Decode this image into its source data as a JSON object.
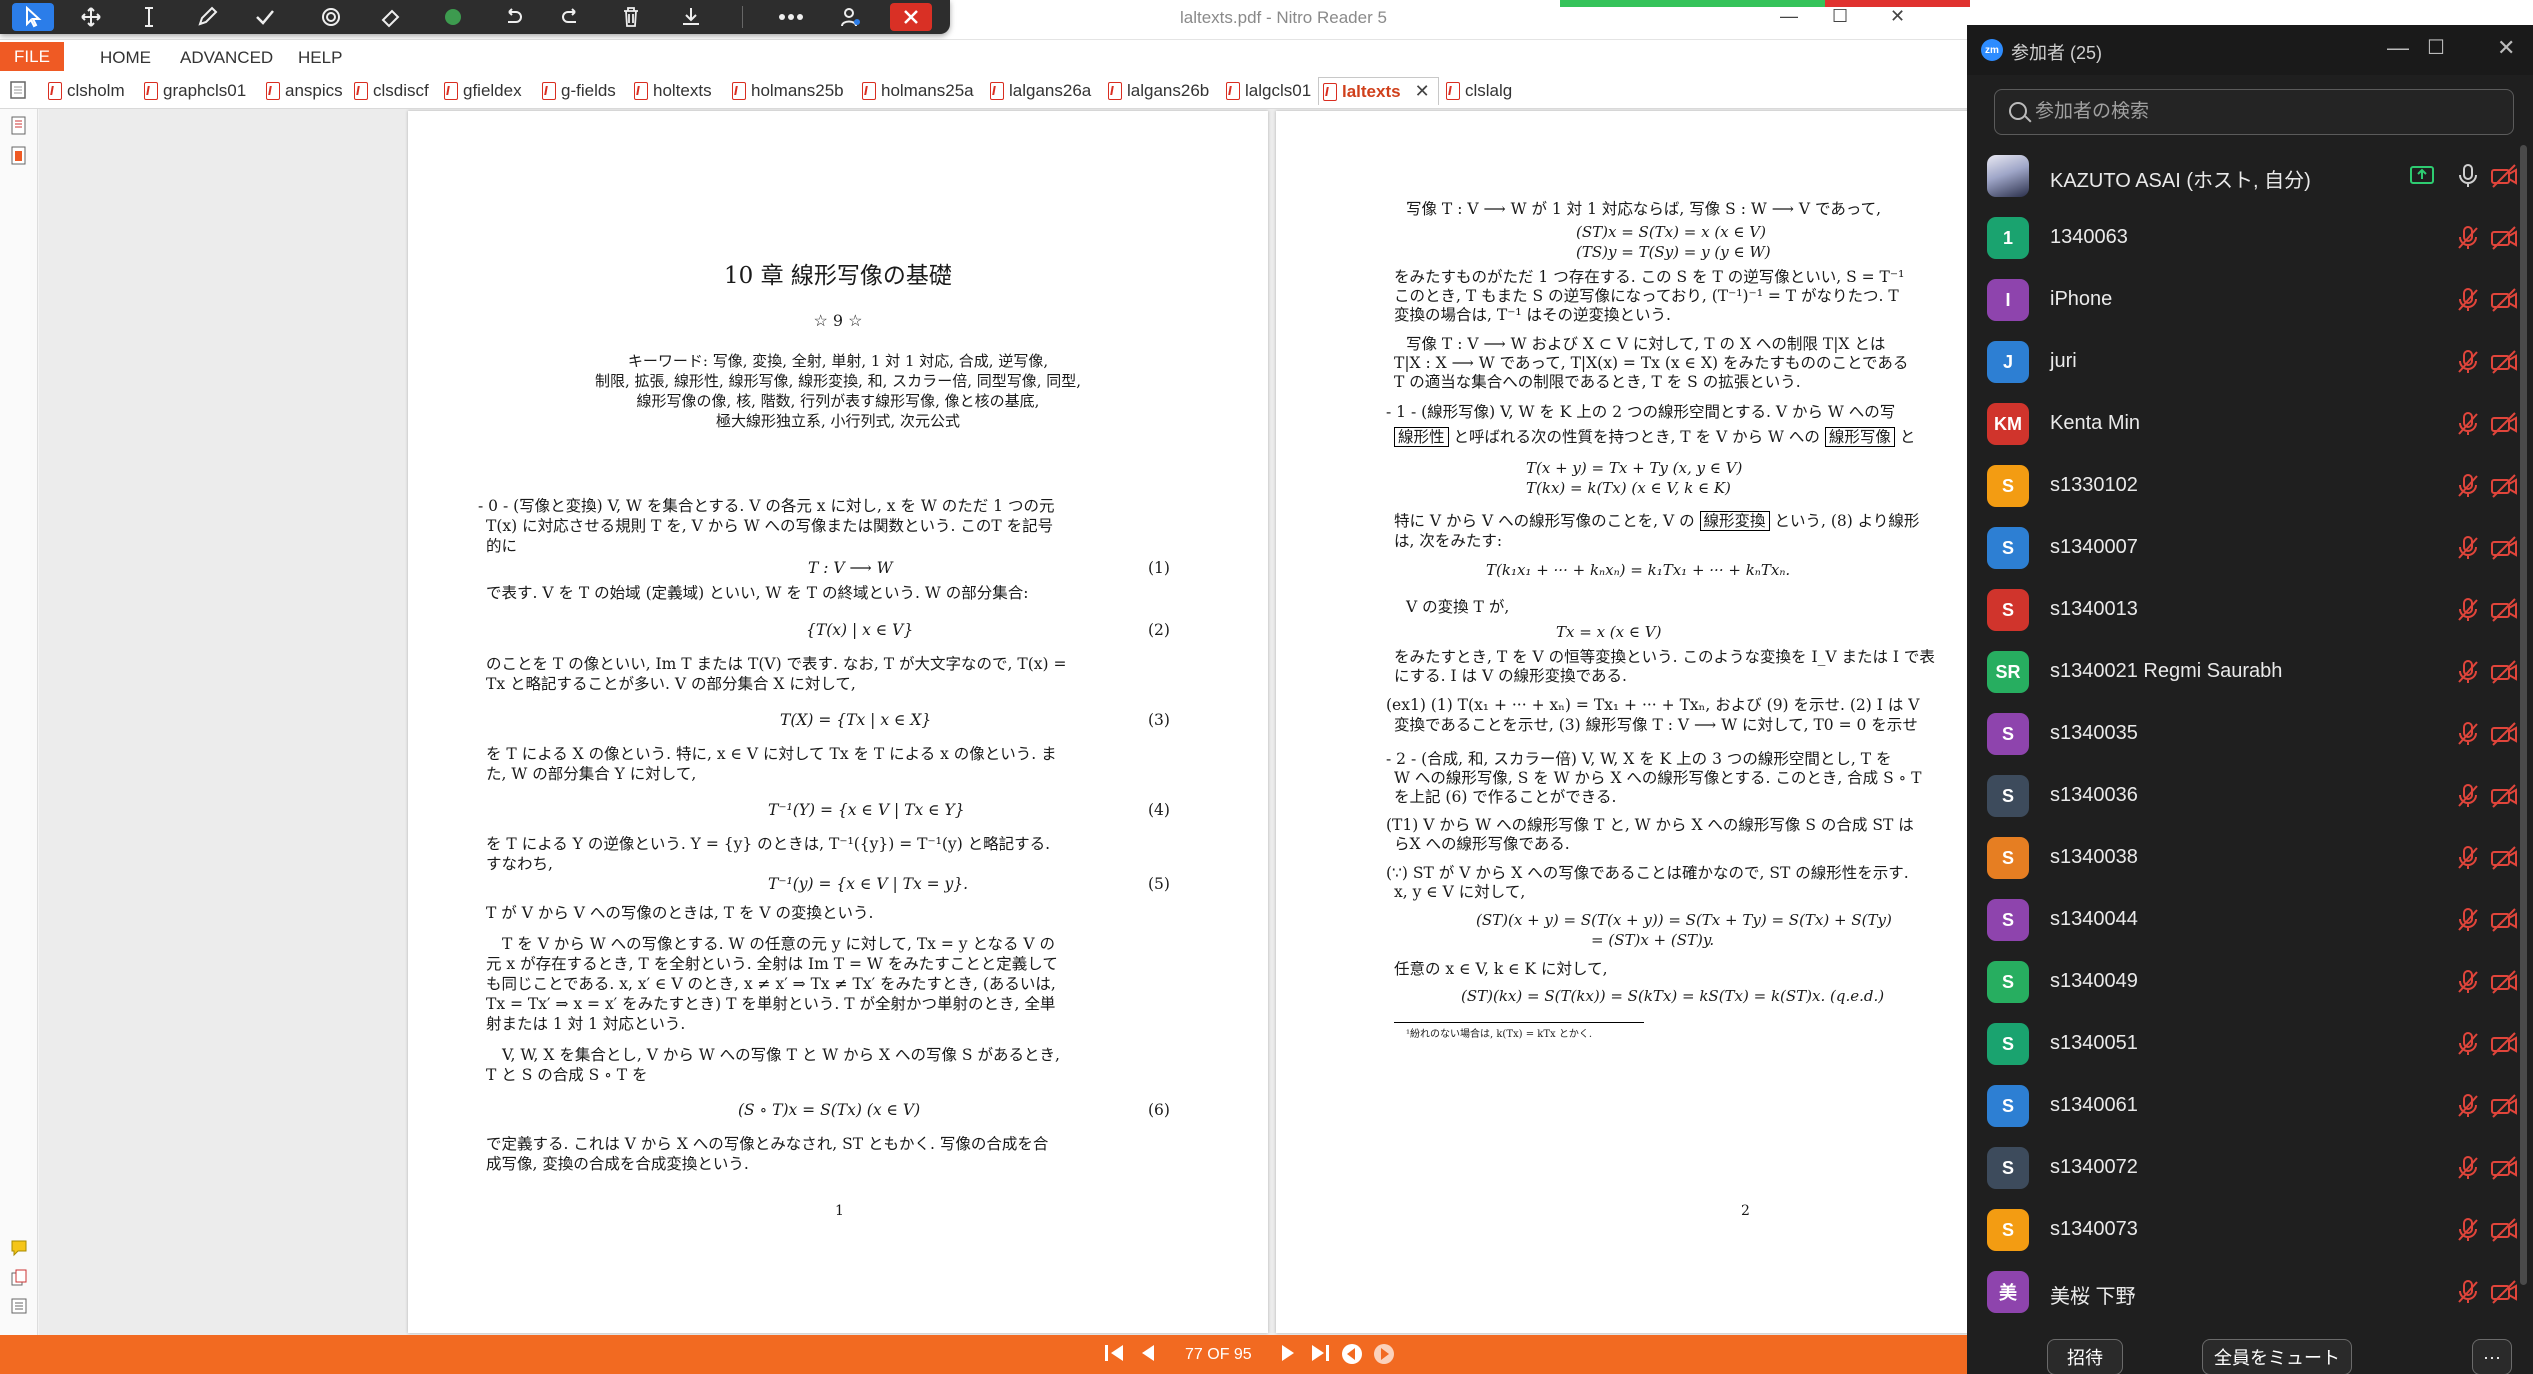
{
  "window": {
    "title": "laltexts.pdf - Nitro Reader 5",
    "min": "—",
    "max": "☐",
    "close": "✕"
  },
  "menu": {
    "file": "FILE",
    "home": "HOME",
    "advanced": "ADVANCED",
    "help": "HELP"
  },
  "tabs": [
    {
      "label": "clsholm"
    },
    {
      "label": "graphcls01"
    },
    {
      "label": "anspics"
    },
    {
      "label": "clsdiscf"
    },
    {
      "label": "gfieldex"
    },
    {
      "label": "g-fields"
    },
    {
      "label": "holtexts"
    },
    {
      "label": "holmans25b"
    },
    {
      "label": "holmans25a"
    },
    {
      "label": "lalgans26a"
    },
    {
      "label": "lalgans26b"
    },
    {
      "label": "lalgcls01"
    },
    {
      "label": "laltexts",
      "active": true
    },
    {
      "label": "clslalg"
    }
  ],
  "page1": {
    "title": "10 章 線形写像の基礎",
    "stars": "☆ 9 ☆",
    "keywords": [
      "キーワード: 写像, 変換, 全射, 単射, 1 対 1 対応, 合成, 逆写像,",
      "制限, 拡張, 線形性, 線形写像, 線形変換, 和, スカラー倍, 同型写像, 同型,",
      "線形写像の像, 核, 階数, 行列が表す線形写像, 像と核の基底,",
      "極大線形独立系, 小行列式, 次元公式"
    ],
    "lines": [
      "- 0 - (写像と変換) V, W を集合とする. V の各元 x に対し, x を W のただ 1 つの元",
      "T(x) に対応させる規則 T を, V から W への写像または関数という. このT を記号",
      "的に",
      "で表す. V を T の始域 (定義域) といい, W を T の終域という. W の部分集合:",
      "のことを T の像といい, Im T または T(V) で表す. なお, T が大文字なので, T(x) =",
      "Tx と略記することが多い. V の部分集合 X に対して,",
      "を T による X の像という. 特に, x ∈ V に対して Tx を T による x の像という. ま",
      "た, W の部分集合 Y に対して,",
      "を T による Y の逆像という. Y = {y} のときは, T⁻¹({y}) = T⁻¹(y) と略記する.",
      "すなわち,",
      "T が V から V への写像のときは, T を V の変換という.",
      "T を V から W への写像とする. W の任意の元 y に対して, Tx = y となる V の",
      "元 x が存在するとき, T を全射という. 全射は Im T = W をみたすことと定義して",
      "も同じことである. x, x′ ∈ V のとき, x ≠ x′ ⇒ Tx ≠ Tx′ をみたすとき, (あるいは,",
      "Tx = Tx′ ⇒ x = x′ をみたすとき) T を単射という. T が全射かつ単射のとき, 全単",
      "射または 1 対 1 対応という.",
      "V, W, X を集合とし, V から W への写像 T と W から X への写像 S があるとき,",
      "T と S の合成 S ∘ T を",
      "で定義する. これは V から X への写像とみなされ, ST ともかく. 写像の合成を合",
      "成写像, 変換の合成を合成変換という."
    ],
    "equations": [
      {
        "eq": "T : V ⟶ W",
        "no": "(1)"
      },
      {
        "eq": "{T(x) | x ∈ V}",
        "no": "(2)"
      },
      {
        "eq": "T(X) = {Tx | x ∈ X}",
        "no": "(3)"
      },
      {
        "eq": "T⁻¹(Y) = {x ∈ V | Tx ∈ Y}",
        "no": "(4)"
      },
      {
        "eq": "T⁻¹(y) = {x ∈ V | Tx = y}.",
        "no": "(5)"
      },
      {
        "eq": "(S ∘ T)x = S(Tx)      (x ∈ V)",
        "no": "(6)"
      }
    ],
    "page_number": "1"
  },
  "page2": {
    "lines": [
      "写像 T : V ⟶ W が 1 対 1 対応ならば, 写像 S : W ⟶ V であって,",
      "(ST)x = S(Tx) = x        (x ∈ V)",
      "(TS)y = T(Sy) = y        (y ∈ W)",
      "をみたすものがただ 1 つ存在する. この S を T の逆写像といい, S = T⁻¹",
      "このとき, T もまた S の逆写像になっており, (T⁻¹)⁻¹ = T がなりたつ. T",
      "変換の場合は, T⁻¹ はその逆変換という.",
      "写像 T : V ⟶ W および X ⊂ V に対して, T の X への制限 T|X とは",
      "T|X : X ⟶ W であって, T|X(x) = Tx (x ∈ X) をみたすもののことである",
      "T の適当な集合への制限であるとき, T を S の拡張という.",
      "- 1 - (線形写像) V, W を K 上の 2 つの線形空間とする. V から W への写",
      "と呼ばれる次の性質を持つとき, T を V から W への",
      "T(x + y) = Tx + Ty      (x, y ∈ V)",
      "T(kx) = k(Tx)      (x ∈ V, k ∈ K)",
      "特に V から V への線形写像のことを, V の",
      "という, (8) より線形",
      "は, 次をみたす:",
      "T(k₁x₁ + ··· + kₙxₙ) = k₁Tx₁ + ··· + kₙTxₙ.",
      "V の変換 T が,",
      "Tx = x      (x ∈ V)",
      "をみたすとき, T を V の恒等変換という. このような変換を I_V または I で表",
      "にする. I は V の線形変換である.",
      "(ex1) (1) T(x₁ + ··· + xₙ) = Tx₁ + ··· + Txₙ, および (9) を示せ.   (2) I は V",
      "変換であることを示せ,  (3) 線形写像 T : V ⟶ W に対して, T0 = 0 を示せ",
      "- 2 - (合成, 和, スカラー倍) V, W, X を K 上の 3 つの線形空間とし, T を",
      "W への線形写像, S を W から X への線形写像とする. このとき, 合成 S ∘ T",
      "を上記 (6) で作ることができる.",
      "(T1) V から W への線形写像 T と, W から X への線形写像 S の合成 ST は",
      "らX への線形写像である.",
      "(∵) ST が V から X への写像であることは確かなので, ST の線形性を示す.",
      "x, y ∈ V に対して,",
      "(ST)(x + y)   = S(T(x + y)) = S(Tx + Ty) = S(Tx) + S(Ty)",
      "= (ST)x + (ST)y.",
      "任意の x ∈ V,  k ∈ K に対して,",
      "(ST)(kx) = S(T(kx)) = S(kTx) = kS(Tx) = k(ST)x.        (q.e.d.)",
      "¹紛れのない場合は, k(Tx) = kTx とかく."
    ],
    "boxed": [
      "線形性",
      "線形写像",
      "線形変換"
    ],
    "box_suffix": "と",
    "page_number": "2"
  },
  "status": {
    "page_indicator": "77 OF 95"
  },
  "zoom": {
    "logo": "zm",
    "title": "参加者 (25)",
    "search_placeholder": "参加者の検索",
    "participants": [
      {
        "name": "KAZUTO ASAI (ホスト, 自分)",
        "initials": "",
        "color": "#444",
        "photo": true,
        "muted": false
      },
      {
        "name": "1340063",
        "initials": "1",
        "color": "#1aa36f"
      },
      {
        "name": "iPhone",
        "initials": "I",
        "color": "#8e44ad"
      },
      {
        "name": "juri",
        "initials": "J",
        "color": "#2d7fd3"
      },
      {
        "name": "Kenta Min",
        "initials": "KM",
        "color": "#d0342c"
      },
      {
        "name": "s1330102",
        "initials": "S",
        "color": "#f39c12"
      },
      {
        "name": "s1340007",
        "initials": "S",
        "color": "#2d7fd3"
      },
      {
        "name": "s1340013",
        "initials": "S",
        "color": "#d0342c"
      },
      {
        "name": "s1340021 Regmi Saurabh",
        "initials": "SR",
        "color": "#27ae60"
      },
      {
        "name": "s1340035",
        "initials": "S",
        "color": "#8e44ad"
      },
      {
        "name": "s1340036",
        "initials": "S",
        "color": "#3d4b5c"
      },
      {
        "name": "s1340038",
        "initials": "S",
        "color": "#e67e22"
      },
      {
        "name": "s1340044",
        "initials": "S",
        "color": "#8e44ad"
      },
      {
        "name": "s1340049",
        "initials": "S",
        "color": "#27ae60"
      },
      {
        "name": "s1340051",
        "initials": "S",
        "color": "#1aa36f"
      },
      {
        "name": "s1340061",
        "initials": "S",
        "color": "#2d7fd3"
      },
      {
        "name": "s1340072",
        "initials": "S",
        "color": "#3d4b5c"
      },
      {
        "name": "s1340073",
        "initials": "S",
        "color": "#f39c12"
      },
      {
        "name": "美桜 下野",
        "initials": "美",
        "color": "#8e44ad"
      }
    ],
    "invite": "招待",
    "mute_all": "全員をミュート",
    "more": "···"
  }
}
